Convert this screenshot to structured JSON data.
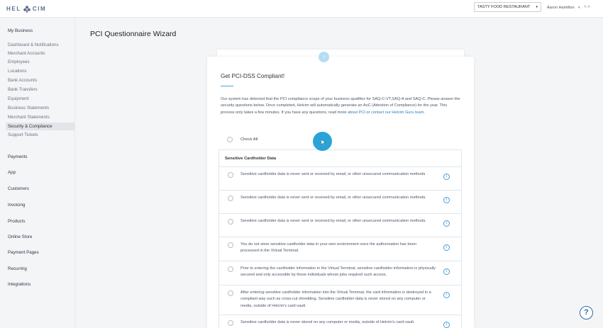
{
  "header": {
    "logo_left": "HEL",
    "logo_right": "CIM",
    "logo_icon": "helcim-logo-icon",
    "merchant_selected": "TASTY FOOD RESTAURANT",
    "user_name": "Aaron Hamilton",
    "user_initials": "A-A"
  },
  "sidebar": {
    "my_business": "My Business",
    "items": [
      "Dashboard & Notifications",
      "Merchant Accounts",
      "Employees",
      "Locations",
      "Bank Accounts",
      "Bank Transfers",
      "Equipment",
      "Business Statements",
      "Merchant Statements",
      "Security & Compliance",
      "Support Tickets"
    ],
    "active_item": "Security & Compliance",
    "sections": [
      "Payments",
      "App",
      "Customers",
      "Invoicing",
      "Products",
      "Online Store",
      "Payment Pages",
      "Recurring",
      "Integrations"
    ]
  },
  "page": {
    "title": "PCI Questionnaire Wizard"
  },
  "wizard": {
    "heading": "Get PCI-DSS Compliant!",
    "intro_main": "Our system has detected that the PCI compliance scope of your business qualifies for SAQ-C-VT,SAQ-A and SAQ-C. Please answer the security questions below. Once completed, Helcim will automatically generate an AoC (Attestion of Compliance) for the year. This process only takes a few minutes. If you have any questions, read more ",
    "link_about_pci": "about PCI",
    "intro_or": " or ",
    "link_guru": "contact our Helcim Guru team.",
    "check_all": "Check All",
    "section_header": "Sensitive Cardholder Data",
    "questions": [
      "Sensitive cardholder data is never sent or received by email, or other unsecured communication methods",
      "Sensitive cardholder data is never sent or received by email, or other unsecured communication methods.",
      "Sensitive cardholder data is never sent or received by email, or other unsecured communication methods.",
      "You do not store sensitive cardholder data in your own environment once the authorization has been processed in the Virtual Terminal.",
      "Prior to entering the cardholder information in the Virtual Terminal, sensitive cardholder information is physically secured and only accessible by those individuals whose jobs required such access.",
      "After entering sensitive cardholder information into the Virtual Terminal, the card information is destroyed in a compliant way such as cross-cut shredding. Sensitive cardholder data is never stored on any computer or media, outside of Helcim's card-vault.",
      "Sensitive cardholder data is never stored on any computer or media, outside of Helcim's card-vault."
    ],
    "info_glyph": "i",
    "up_glyph": "↑"
  },
  "help": {
    "glyph": "?"
  },
  "colors": {
    "accent": "#2aa3d8",
    "link": "#2b7bb9",
    "info": "#4a9bd6"
  }
}
